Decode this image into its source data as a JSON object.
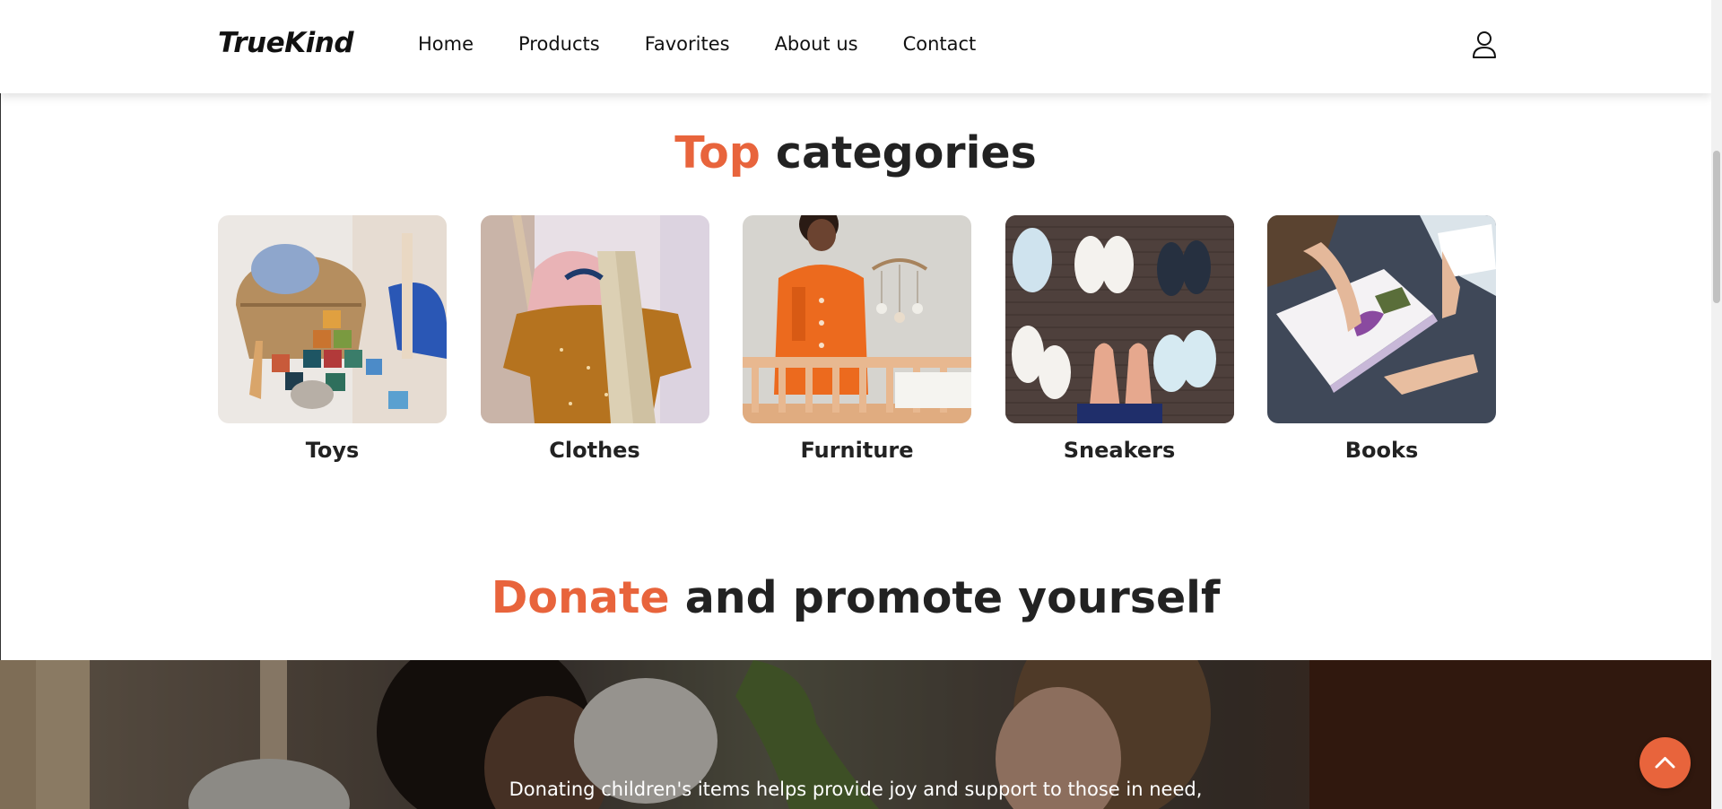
{
  "header": {
    "logo": "TrueKind",
    "nav": [
      {
        "label": "Home"
      },
      {
        "label": "Products"
      },
      {
        "label": "Favorites"
      },
      {
        "label": "About us"
      },
      {
        "label": "Contact"
      }
    ],
    "user_icon": "user-icon"
  },
  "top_categories": {
    "title_accent": "Top",
    "title_rest": " categories",
    "items": [
      {
        "label": "Toys"
      },
      {
        "label": "Clothes"
      },
      {
        "label": "Furniture"
      },
      {
        "label": "Sneakers"
      },
      {
        "label": "Books"
      }
    ]
  },
  "donate": {
    "title_accent": "Donate",
    "title_rest": " and promote yourself",
    "banner_text": "Donating children's items helps provide joy and support to those in need,"
  },
  "scroll_top_icon": "chevron-up-icon",
  "colors": {
    "accent": "#e8643c"
  }
}
